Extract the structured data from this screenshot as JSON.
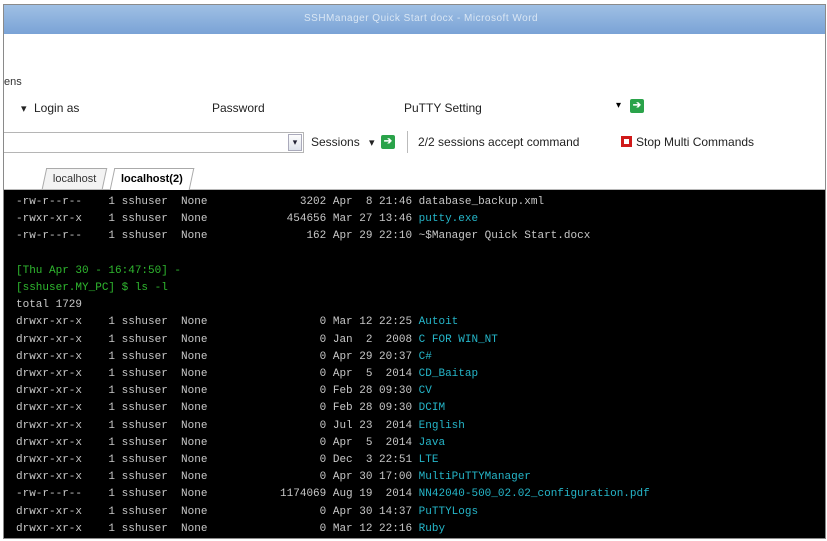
{
  "window": {
    "title": "SSHManager Quick Start docx - Microsoft Word"
  },
  "menu_fragment": "ens",
  "toolbar": {
    "login_label": "Login as",
    "login_arrow": "▾",
    "password_label": "Password",
    "putty_label": "PuTTY Setting",
    "sessions_label": "Sessions",
    "sessions_arrow": "▾",
    "status_text": "2/2 sessions accept command",
    "stop_label": "Stop Multi Commands",
    "go_glyph": "➔"
  },
  "tabs": [
    {
      "label": "localhost",
      "active": false
    },
    {
      "label": "localhost(2)",
      "active": true
    }
  ],
  "terminal": {
    "lines": [
      {
        "text": "-rw-r--r--    1 sshuser  None              3202 Apr  8 21:46 database_backup.xml",
        "parts": []
      },
      {
        "text": "-rwxr-xr-x    1 sshuser  None            454656 Mar 27 13:46 ",
        "name": "putty.exe"
      },
      {
        "text": "-rw-r--r--    1 sshuser  None               162 Apr 29 22:10 ~$Manager Quick Start.docx"
      },
      {
        "text": ""
      },
      {
        "text": "[Thu Apr 30 - 16:47:50] -",
        "style": "g"
      },
      {
        "text": "[sshuser.MY_PC] $ ls -l",
        "style": "g",
        "cmd": true
      },
      {
        "text": "total 1729"
      },
      {
        "text": "drwxr-xr-x    1 sshuser  None                 0 Mar 12 22:25 ",
        "name": "Autoit"
      },
      {
        "text": "drwxr-xr-x    1 sshuser  None                 0 Jan  2  2008 ",
        "name": "C FOR WIN_NT"
      },
      {
        "text": "drwxr-xr-x    1 sshuser  None                 0 Apr 29 20:37 ",
        "name": "C#"
      },
      {
        "text": "drwxr-xr-x    1 sshuser  None                 0 Apr  5  2014 ",
        "name": "CD_Baitap"
      },
      {
        "text": "drwxr-xr-x    1 sshuser  None                 0 Feb 28 09:30 ",
        "name": "CV"
      },
      {
        "text": "drwxr-xr-x    1 sshuser  None                 0 Feb 28 09:30 ",
        "name": "DCIM"
      },
      {
        "text": "drwxr-xr-x    1 sshuser  None                 0 Jul 23  2014 ",
        "name": "English"
      },
      {
        "text": "drwxr-xr-x    1 sshuser  None                 0 Apr  5  2014 ",
        "name": "Java"
      },
      {
        "text": "drwxr-xr-x    1 sshuser  None                 0 Dec  3 22:51 ",
        "name": "LTE"
      },
      {
        "text": "drwxr-xr-x    1 sshuser  None                 0 Apr 30 17:00 ",
        "name": "MultiPuTTYManager"
      },
      {
        "text": "-rw-r--r--    1 sshuser  None           1174069 Aug 19  2014 ",
        "name": "NN42040-500_02.02_configuration.pdf"
      },
      {
        "text": "drwxr-xr-x    1 sshuser  None                 0 Apr 30 14:37 ",
        "name": "PuTTYLogs"
      },
      {
        "text": "drwxr-xr-x    1 sshuser  None                 0 Mar 12 22:16 ",
        "name": "Ruby"
      }
    ]
  }
}
